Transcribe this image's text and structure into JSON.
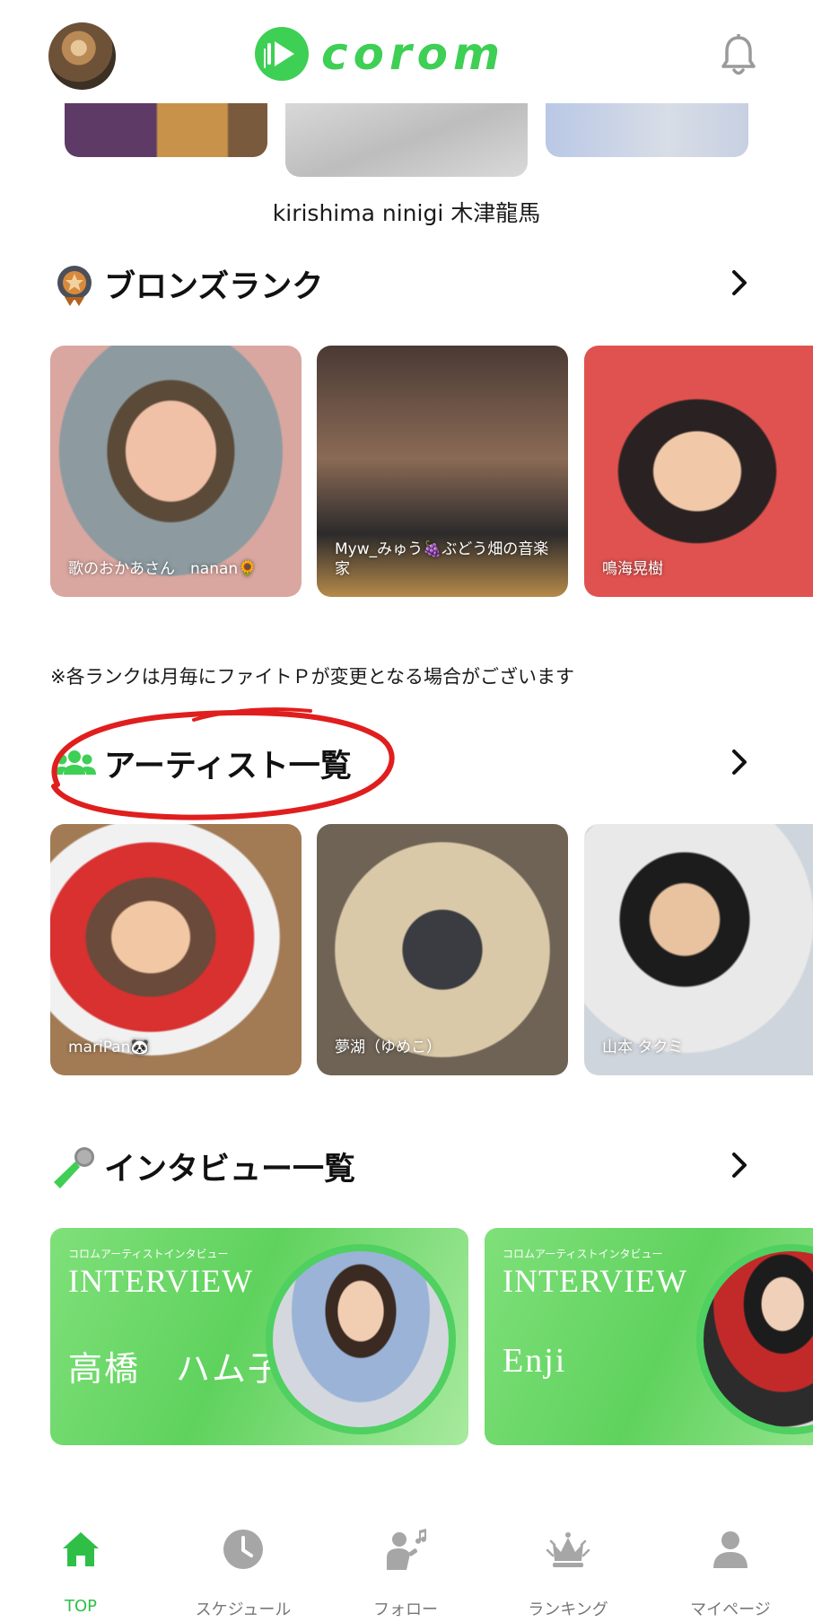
{
  "header": {
    "logo_text": "corom",
    "avatar": "profile-avatar",
    "bell_icon": "bell-icon"
  },
  "top_section": {
    "caption": "kirishima ninigi 木津龍馬"
  },
  "bronze_rank": {
    "title": "ブロンズランク",
    "icon": "bronze-medal-icon",
    "cards": [
      {
        "label": "歌のおかあさん　nanan🌻"
      },
      {
        "label": "Myw_みゅう🍇ぶどう畑の音楽家"
      },
      {
        "label": "鳴海晃樹"
      }
    ]
  },
  "rank_note": "※各ランクは月毎にファイトＰが変更となる場合がございます",
  "artist_list": {
    "title": "アーティスト一覧",
    "icon": "users-icon",
    "cards": [
      {
        "label": "mariPan🐼"
      },
      {
        "label": "夢湖（ゆめこ）"
      },
      {
        "label": "山本 タクミ"
      }
    ]
  },
  "interview_list": {
    "title": "インタビュー一覧",
    "icon": "microphone-icon",
    "cards": [
      {
        "subtitle": "コロムアーティストインタビュー",
        "heading": "INTERVIEW",
        "name": "高橋　ハム子"
      },
      {
        "subtitle": "コロムアーティストインタビュー",
        "heading": "INTERVIEW",
        "name": "Enji"
      }
    ]
  },
  "tabbar": {
    "items": [
      {
        "label": "TOP",
        "icon": "home-icon",
        "active": true
      },
      {
        "label": "スケジュール",
        "icon": "clock-icon",
        "active": false
      },
      {
        "label": "フォロー",
        "icon": "follow-singer-icon",
        "active": false
      },
      {
        "label": "ランキング",
        "icon": "crown-icon",
        "active": false
      },
      {
        "label": "マイページ",
        "icon": "user-icon",
        "active": false
      }
    ]
  },
  "colors": {
    "brand_green": "#3ecf55",
    "tab_active": "#2fbf47",
    "tab_inactive": "#9a9a9a",
    "annotation_red": "#e01e1e"
  }
}
